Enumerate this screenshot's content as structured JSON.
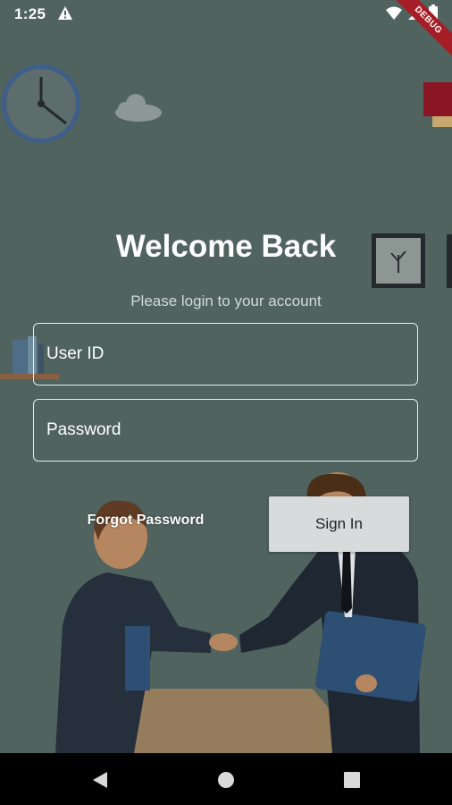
{
  "status_bar": {
    "time": "1:25",
    "debug_label": "DEBUG"
  },
  "login": {
    "title": "Welcome Back",
    "subtitle": "Please login to your account",
    "user_id_placeholder": "User ID",
    "password_placeholder": "Password",
    "forgot_label": "Forgot Password",
    "sign_in_label": "Sign In"
  },
  "colors": {
    "background": "#50635f",
    "field_border": "#e6ecea",
    "sign_in_bg": "#d7dbdc",
    "debug_banner": "#a51e25"
  },
  "icons": [
    "warning-icon",
    "wifi-icon",
    "signal-icon",
    "battery-icon",
    "back-icon",
    "home-icon",
    "recents-icon"
  ]
}
